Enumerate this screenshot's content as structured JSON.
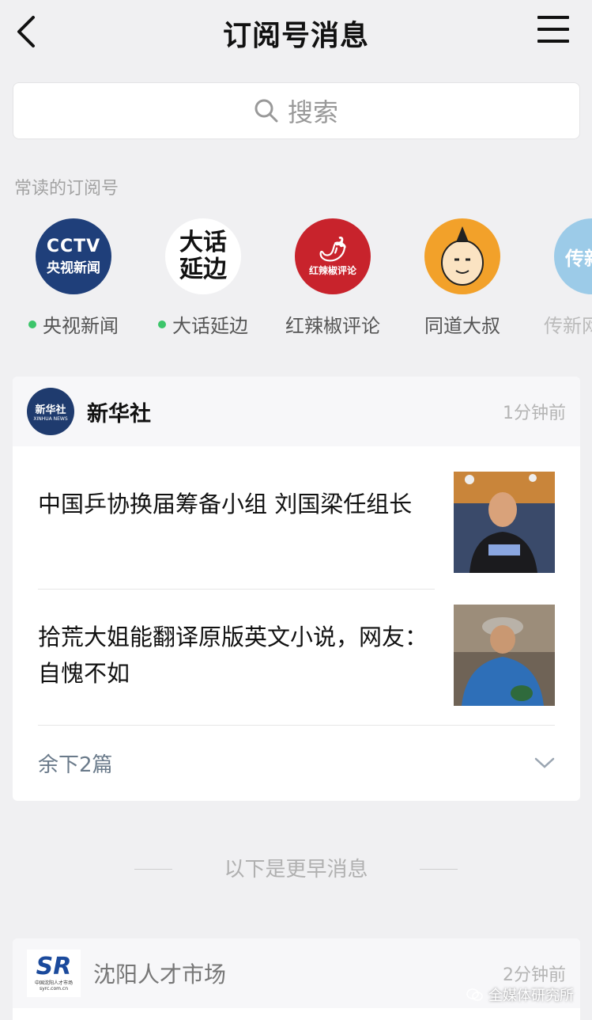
{
  "header": {
    "title": "订阅号消息"
  },
  "search": {
    "placeholder": "搜索"
  },
  "frequent": {
    "label": "常读的订阅号",
    "accounts": [
      {
        "name": "央视新闻",
        "new": true,
        "logo_text": "CCTV",
        "logo_sub": "央视新闻"
      },
      {
        "name": "大话延边",
        "new": true,
        "logo_text": "大话",
        "logo_sub": "延边"
      },
      {
        "name": "红辣椒评论",
        "new": false,
        "logo_text": "红辣椒评论"
      },
      {
        "name": "同道大叔",
        "new": false
      },
      {
        "name": "传新网",
        "new": false,
        "logo_text": "传新"
      }
    ]
  },
  "publisher1": {
    "name": "新华社",
    "time": "1分钟前",
    "logo_text": "新华社",
    "logo_sub": "XINHUA NEWS",
    "articles": [
      {
        "title": "中国乒协换届筹备小组 刘国梁任组长"
      },
      {
        "title": "拾荒大姐能翻译原版英文小说，网友：自愧不如"
      }
    ],
    "more_label": "余下2篇"
  },
  "earlier_label": "以下是更早消息",
  "publisher2": {
    "name": "沈阳人才市场",
    "time": "2分钟前",
    "logo_caption": "中国沈阳人才市场",
    "logo_url": "syrc.com.cn"
  },
  "watermark": {
    "text": "全媒体研究所"
  },
  "colors": {
    "green_dot": "#3cc56a",
    "background": "#f0f0f2"
  }
}
